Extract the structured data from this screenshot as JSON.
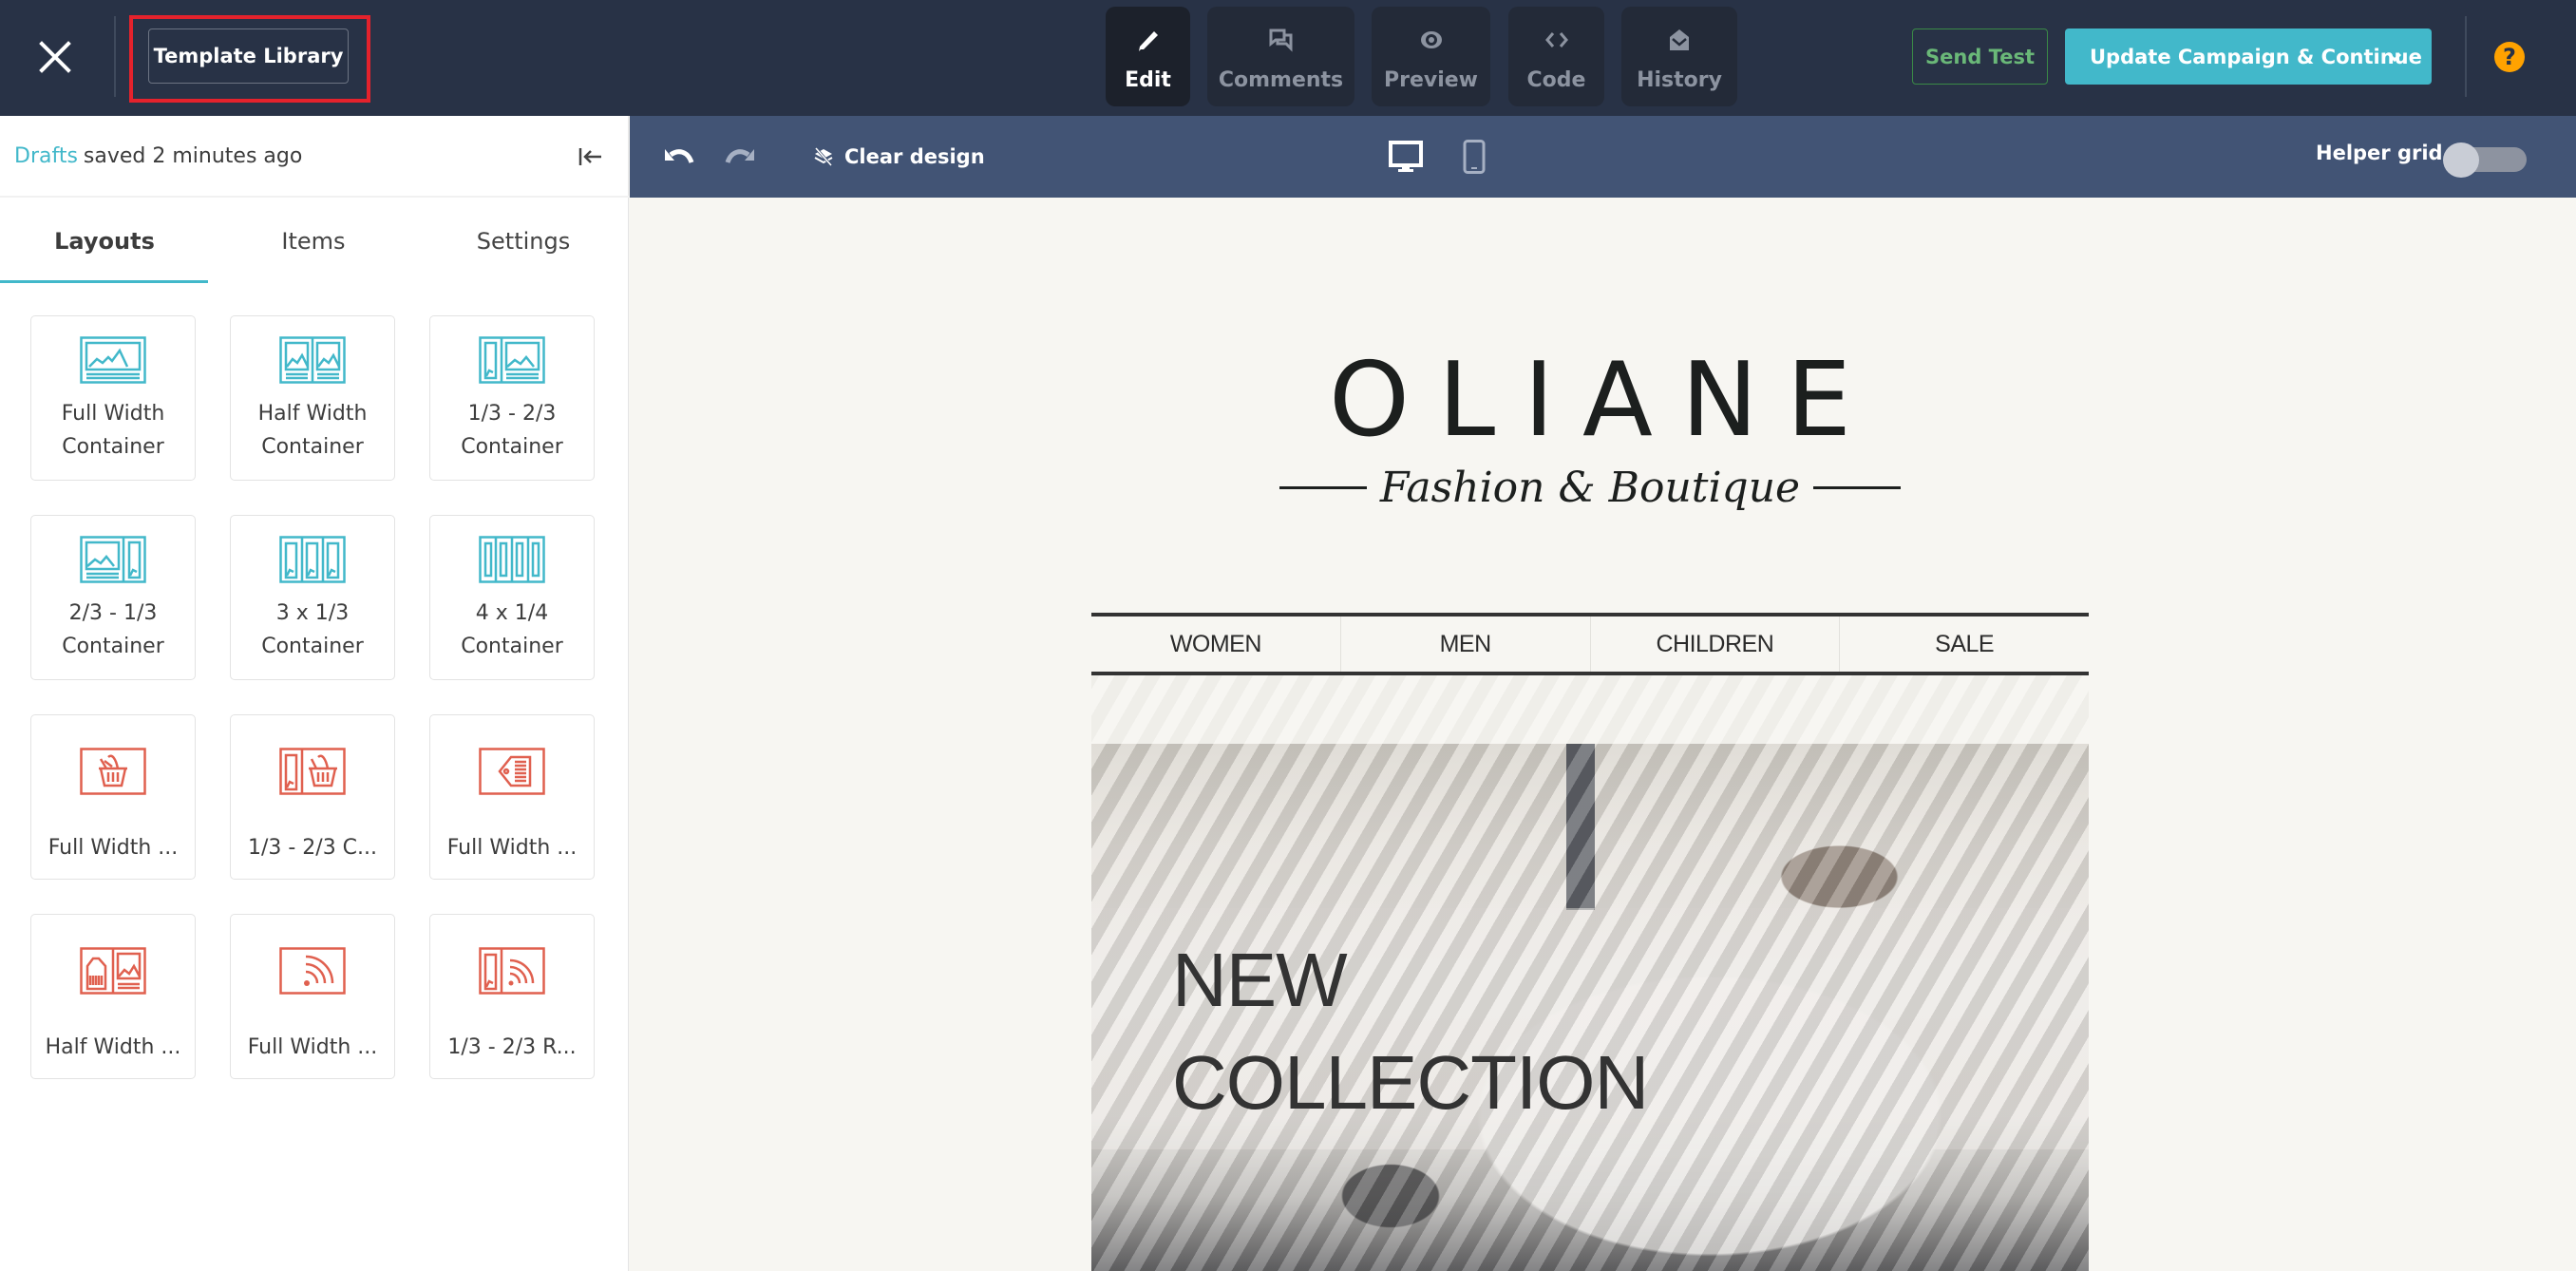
{
  "header": {
    "close_icon": "close-icon",
    "template_library_label": "Template Library",
    "modes": [
      {
        "label": "Edit",
        "icon": "pencil-icon",
        "active": true
      },
      {
        "label": "Comments",
        "icon": "comments-icon",
        "active": false
      },
      {
        "label": "Preview",
        "icon": "eye-icon",
        "active": false
      },
      {
        "label": "Code",
        "icon": "code-icon",
        "active": false
      },
      {
        "label": "History",
        "icon": "history-envelope-icon",
        "active": false
      }
    ],
    "send_test_label": "Send Test",
    "update_label": "Update Campaign & Continue",
    "help_label": "?"
  },
  "sidebar": {
    "status": {
      "drafts_link": "Drafts",
      "saved_text": "saved 2 minutes ago"
    },
    "tabs": [
      {
        "label": "Layouts",
        "active": true
      },
      {
        "label": "Items",
        "active": false
      },
      {
        "label": "Settings",
        "active": false
      }
    ],
    "layouts": [
      {
        "label": "Full Width Container",
        "icon": "full-width-container-icon",
        "color": "teal"
      },
      {
        "label": "Half Width Container",
        "icon": "half-width-container-icon",
        "color": "teal"
      },
      {
        "label": "1/3 - 2/3 Container",
        "icon": "one-third-two-thirds-container-icon",
        "color": "teal"
      },
      {
        "label": "2/3 - 1/3 Container",
        "icon": "two-thirds-one-third-container-icon",
        "color": "teal"
      },
      {
        "label": "3 x 1/3 Container",
        "icon": "three-column-container-icon",
        "color": "teal"
      },
      {
        "label": "4 x 1/4 Container",
        "icon": "four-column-container-icon",
        "color": "teal"
      },
      {
        "label": "Full Width ...",
        "icon": "full-width-basket-icon",
        "color": "red"
      },
      {
        "label": "1/3 - 2/3 C...",
        "icon": "one-third-basket-icon",
        "color": "red"
      },
      {
        "label": "Full Width ...",
        "icon": "full-width-tag-icon",
        "color": "red"
      },
      {
        "label": "Half Width ...",
        "icon": "half-width-tag-icon",
        "color": "red"
      },
      {
        "label": "Full Width ...",
        "icon": "full-width-rss-icon",
        "color": "red"
      },
      {
        "label": "1/3 - 2/3 R...",
        "icon": "one-third-rss-icon",
        "color": "red"
      }
    ]
  },
  "toolbar": {
    "undo_icon": "undo-icon",
    "redo_icon": "redo-icon",
    "clear_design_label": "Clear design",
    "device_desktop": "desktop-icon",
    "device_mobile": "mobile-icon",
    "helper_grid_label": "Helper grid",
    "helper_grid_on": false
  },
  "email": {
    "brand": "OLIANE",
    "tagline": "Fashion & Boutique",
    "nav": [
      "WOMEN",
      "MEN",
      "CHILDREN",
      "SALE"
    ],
    "hero_line1": "NEW",
    "hero_line2": "COLLECTION"
  },
  "colors": {
    "header_bg": "#283246",
    "toolbar_bg": "#425475",
    "accent_teal": "#42b8ca",
    "accent_red": "#e0604f",
    "send_test_green": "#6ab878",
    "help_orange": "#ffa200",
    "highlight_red": "#e4222c",
    "canvas_bg": "#f7f6f2"
  }
}
